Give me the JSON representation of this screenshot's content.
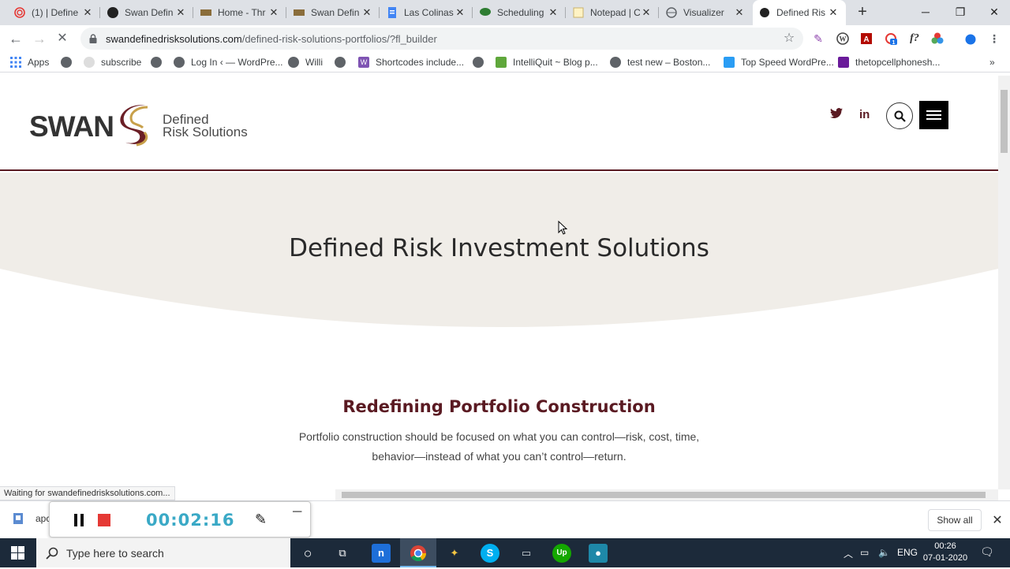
{
  "browser": {
    "tabs": [
      {
        "title": "(1) | Define",
        "active": false
      },
      {
        "title": "Swan Defin",
        "active": false
      },
      {
        "title": "Home - Thr",
        "active": false
      },
      {
        "title": "Swan Defin",
        "active": false
      },
      {
        "title": "Las Colinas",
        "active": false
      },
      {
        "title": "Scheduling",
        "active": false
      },
      {
        "title": "Notepad | C",
        "active": false
      },
      {
        "title": "Visualizer",
        "active": false
      },
      {
        "title": "Defined Ris",
        "active": true
      }
    ],
    "new_tab_symbol": "+",
    "url_host": "swandefinedrisksolutions.com",
    "url_path": "/defined-risk-solutions-portfolios/?fl_builder",
    "bookmarks": [
      {
        "label": "Apps"
      },
      {
        "label": ""
      },
      {
        "label": "subscribe"
      },
      {
        "label": ""
      },
      {
        "label": "Log In ‹ — WordPre..."
      },
      {
        "label": "Willi"
      },
      {
        "label": ""
      },
      {
        "label": "Shortcodes include..."
      },
      {
        "label": ""
      },
      {
        "label": "IntelliQuit ~ Blog p..."
      },
      {
        "label": "test new – Boston..."
      },
      {
        "label": "Top Speed WordPre..."
      },
      {
        "label": "thetopcellphonesh..."
      }
    ],
    "bookmarks_overflow": "»",
    "extension_badge": "1",
    "status_text": "Waiting for swandefinedrisksolutions.com..."
  },
  "site": {
    "logo_word": "SWAN",
    "logo_line1": "Defined",
    "logo_line2": "Risk Solutions",
    "hero_title": "Defined Risk Investment Solutions",
    "section_title": "Redefining Portfolio Construction",
    "section_body": "Portfolio construction should be focused on what you can control—risk, cost, time, behavior—instead of what you can’t control—return.",
    "social": {
      "twitter": "🐦",
      "linkedin": "in"
    },
    "colors": {
      "brand": "#5a1a22",
      "hero_bg": "#f0ede8"
    }
  },
  "downloads": {
    "item_label": "apc",
    "show_all": "Show all"
  },
  "recorder": {
    "time": "00:02:16"
  },
  "taskbar": {
    "search_placeholder": "Type here to search",
    "language": "ENG",
    "time": "00:26",
    "date": "07-01-2020"
  }
}
